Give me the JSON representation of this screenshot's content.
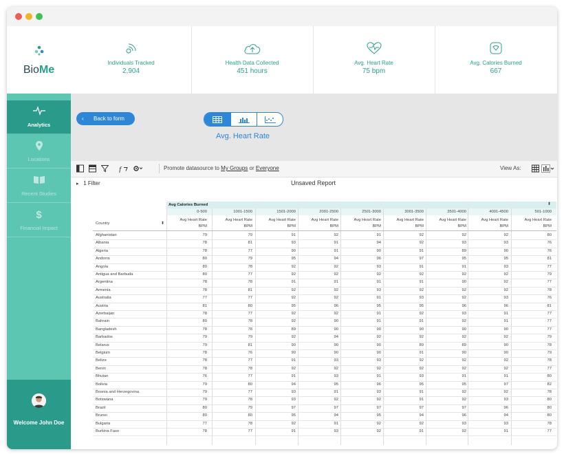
{
  "app": {
    "brand_prefix": "Bio",
    "brand_suffix": "Me"
  },
  "nav": [
    {
      "label": "Analytics",
      "icon": "pulse-icon",
      "active": true
    },
    {
      "label": "Locations",
      "icon": "map-pin-icon",
      "active": false
    },
    {
      "label": "Recent Studies",
      "icon": "book-icon",
      "active": false
    },
    {
      "label": "Financial Impact",
      "icon": "dollar-icon",
      "active": false
    }
  ],
  "user": {
    "welcome": "Welcome John Doe"
  },
  "stats": [
    {
      "label": "Individuals Tracked",
      "value": "2,904",
      "icon": "signal-icon"
    },
    {
      "label": "Health Data Collected",
      "value": "451 hours",
      "icon": "cloud-upload-icon"
    },
    {
      "label": "Avg. Heart Rate",
      "value": "75 bpm",
      "icon": "heart-pulse-icon"
    },
    {
      "label": "Avg. Calories Burned",
      "value": "667",
      "icon": "gauge-icon"
    }
  ],
  "controls": {
    "back_label": "Back to form",
    "view_title": "Avg. Heart Rate"
  },
  "toolbar": {
    "promote_text": "Promote datasource to",
    "my_groups": "My Groups",
    "or": "or",
    "everyone": "Everyone",
    "view_as": "View As:"
  },
  "filter": {
    "label": "1 Filter",
    "report_title": "Unsaved Report"
  },
  "table": {
    "group_header": "Avg Calories Burned",
    "row_header": "Country",
    "sub_header_line1": "Avg Heart Rate",
    "sub_header_line2": "BPM",
    "columns": [
      "0-500",
      "1001-1500",
      "1501-2000",
      "2001-2500",
      "2501-3000",
      "3001-3500",
      "3501-4000",
      "4001-4500",
      "501-1000"
    ],
    "rows": [
      {
        "country": "Afghanistan",
        "values": [
          "79",
          "79",
          "91",
          "92",
          "91",
          "92",
          "92",
          "92",
          "80"
        ]
      },
      {
        "country": "Albania",
        "values": [
          "78",
          "81",
          "93",
          "91",
          "94",
          "92",
          "93",
          "93",
          "76"
        ]
      },
      {
        "country": "Algeria",
        "values": [
          "78",
          "77",
          "90",
          "91",
          "90",
          "91",
          "89",
          "90",
          "76"
        ]
      },
      {
        "country": "Andorra",
        "values": [
          "80",
          "79",
          "95",
          "94",
          "96",
          "97",
          "95",
          "95",
          "81"
        ]
      },
      {
        "country": "Angola",
        "values": [
          "80",
          "78",
          "92",
          "92",
          "93",
          "91",
          "91",
          "93",
          "77"
        ]
      },
      {
        "country": "Antigua and Barbuda",
        "values": [
          "80",
          "77",
          "92",
          "92",
          "92",
          "92",
          "92",
          "92",
          "79"
        ]
      },
      {
        "country": "Argentina",
        "values": [
          "78",
          "78",
          "91",
          "91",
          "91",
          "91",
          "90",
          "92",
          "77"
        ]
      },
      {
        "country": "Armenia",
        "values": [
          "78",
          "81",
          "92",
          "92",
          "93",
          "92",
          "92",
          "92",
          "78"
        ]
      },
      {
        "country": "Australia",
        "values": [
          "77",
          "77",
          "92",
          "92",
          "91",
          "93",
          "92",
          "93",
          "76"
        ]
      },
      {
        "country": "Austria",
        "values": [
          "81",
          "80",
          "95",
          "96",
          "95",
          "95",
          "96",
          "96",
          "81"
        ]
      },
      {
        "country": "Azerbaijan",
        "values": [
          "78",
          "77",
          "92",
          "92",
          "91",
          "92",
          "93",
          "91",
          "77"
        ]
      },
      {
        "country": "Bahrain",
        "values": [
          "80",
          "78",
          "92",
          "90",
          "91",
          "91",
          "92",
          "91",
          "77"
        ]
      },
      {
        "country": "Bangladesh",
        "values": [
          "78",
          "78",
          "89",
          "90",
          "90",
          "90",
          "90",
          "90",
          "77"
        ]
      },
      {
        "country": "Barbados",
        "values": [
          "79",
          "79",
          "92",
          "94",
          "92",
          "92",
          "92",
          "92",
          "79"
        ]
      },
      {
        "country": "Belarus",
        "values": [
          "79",
          "81",
          "90",
          "90",
          "90",
          "89",
          "89",
          "90",
          "78"
        ]
      },
      {
        "country": "Belgium",
        "values": [
          "78",
          "76",
          "90",
          "90",
          "90",
          "91",
          "90",
          "90",
          "79"
        ]
      },
      {
        "country": "Belize",
        "values": [
          "78",
          "77",
          "91",
          "93",
          "93",
          "92",
          "92",
          "92",
          "78"
        ]
      },
      {
        "country": "Benin",
        "values": [
          "78",
          "78",
          "92",
          "92",
          "92",
          "92",
          "92",
          "92",
          "77"
        ]
      },
      {
        "country": "Bhutan",
        "values": [
          "76",
          "77",
          "91",
          "93",
          "91",
          "93",
          "91",
          "91",
          "80"
        ]
      },
      {
        "country": "Bolivia",
        "values": [
          "79",
          "80",
          "94",
          "95",
          "96",
          "95",
          "95",
          "97",
          "82"
        ]
      },
      {
        "country": "Bosnia and Herzegovina",
        "values": [
          "79",
          "77",
          "93",
          "91",
          "93",
          "91",
          "92",
          "92",
          "78"
        ]
      },
      {
        "country": "Botswana",
        "values": [
          "79",
          "78",
          "93",
          "92",
          "92",
          "91",
          "92",
          "93",
          "80"
        ]
      },
      {
        "country": "Brazil",
        "values": [
          "80",
          "79",
          "97",
          "97",
          "97",
          "97",
          "97",
          "96",
          "80"
        ]
      },
      {
        "country": "Brunei",
        "values": [
          "80",
          "80",
          "95",
          "94",
          "95",
          "94",
          "96",
          "94",
          "80"
        ]
      },
      {
        "country": "Bulgaria",
        "values": [
          "77",
          "78",
          "92",
          "91",
          "92",
          "92",
          "93",
          "93",
          "78"
        ]
      },
      {
        "country": "Burkina Faso",
        "values": [
          "78",
          "77",
          "91",
          "93",
          "92",
          "91",
          "92",
          "91",
          "77"
        ]
      }
    ]
  }
}
